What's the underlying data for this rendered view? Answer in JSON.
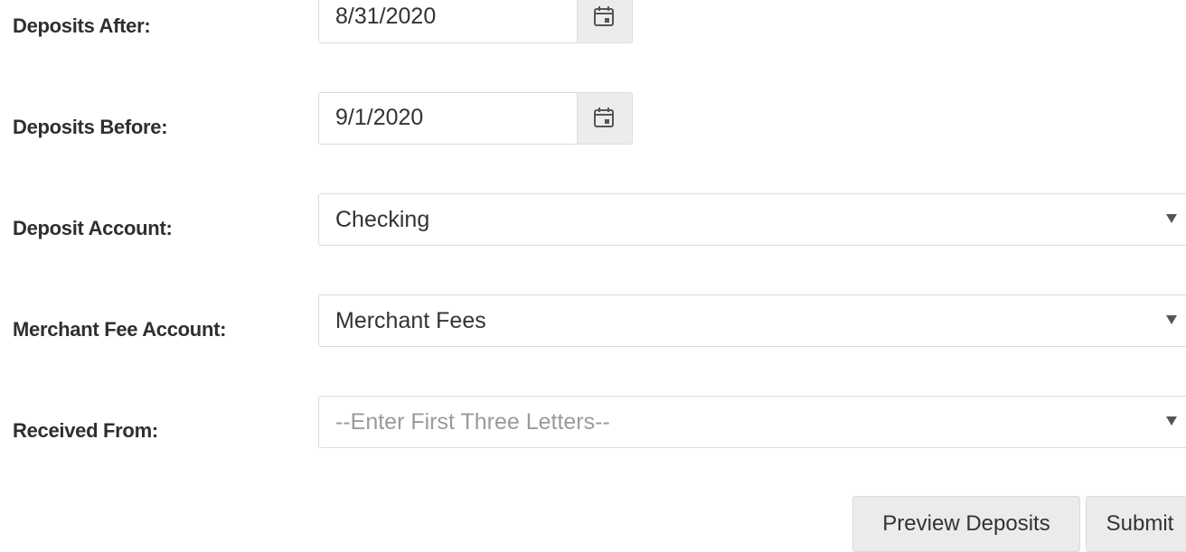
{
  "form": {
    "deposits_after": {
      "label": "Deposits After:",
      "value": "8/31/2020"
    },
    "deposits_before": {
      "label": "Deposits Before:",
      "value": "9/1/2020"
    },
    "deposit_account": {
      "label": "Deposit Account:",
      "value": "Checking"
    },
    "merchant_fee_account": {
      "label": "Merchant Fee Account:",
      "value": "Merchant Fees"
    },
    "received_from": {
      "label": "Received From:",
      "placeholder": "--Enter First Three Letters--"
    }
  },
  "actions": {
    "preview_label": "Preview Deposits",
    "submit_label": "Submit"
  },
  "icons": {
    "date_picker": "calendar-icon",
    "dropdown": "caret-down-icon"
  }
}
